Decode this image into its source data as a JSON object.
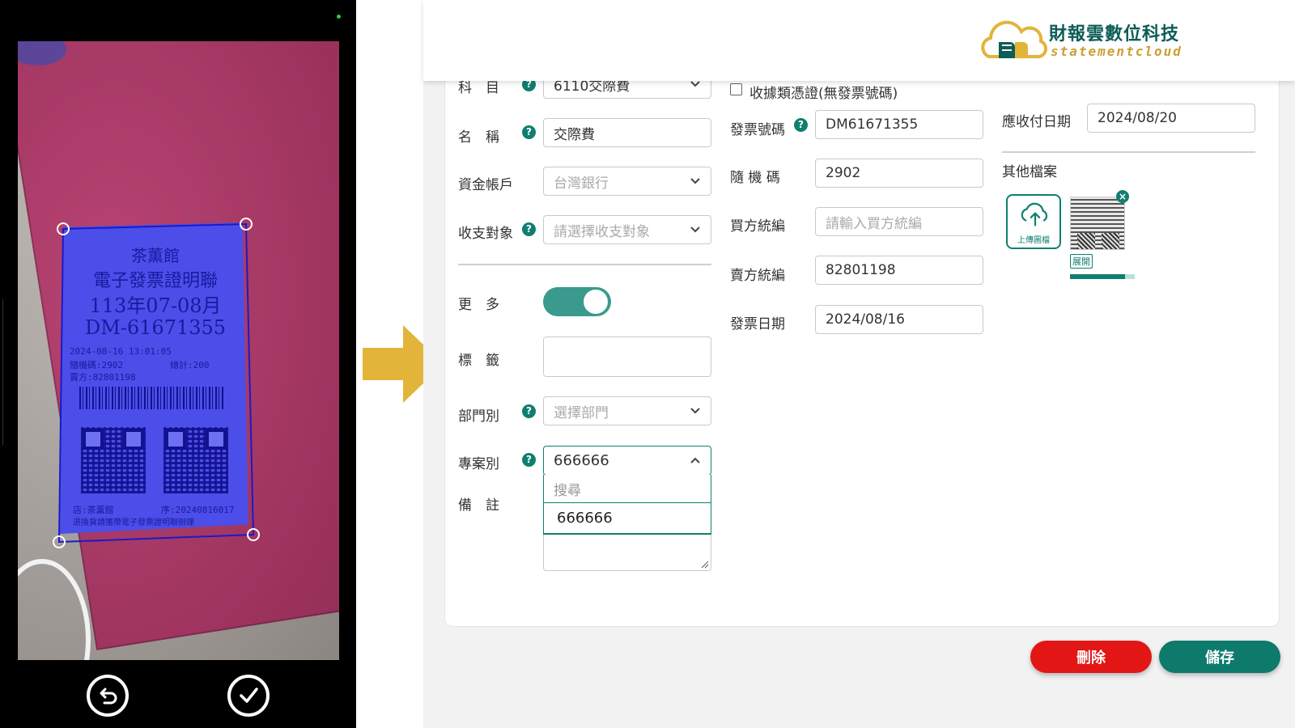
{
  "phone": {
    "receipt": {
      "store": "茶薫館",
      "title": "電子發票證明聯",
      "period": "113年07-08月",
      "number": "DM-61671355",
      "datetime": "2024-08-16 13:01:05",
      "random_code": "隨機碼:2902",
      "total": "總計:200",
      "seller": "賣方:82801198",
      "footer_store": "店:茶薫館",
      "footer_seq": "序:20240816017",
      "footer_note": "退換貨請攜帶電子發票證明聯辦理"
    },
    "icons": {
      "back": "undo-icon",
      "confirm": "check-icon"
    },
    "status_dot_color": "#2ecc40",
    "crop_overlay_color": "#4b4ee8"
  },
  "arrow_color": "#e2b43a",
  "brand": {
    "name_cn": "財報雲數位科技",
    "name_en": "statementcloud",
    "logo_icon": "cloud-book-logo",
    "primary": "#0d5c57",
    "accent": "#c9a033"
  },
  "form": {
    "account": {
      "label": "科　目",
      "value": "6110交際費"
    },
    "name": {
      "label": "名　稱",
      "value": "交際費"
    },
    "fund_account": {
      "label": "資金帳戶",
      "value": "台灣銀行"
    },
    "counterparty": {
      "label": "收支對象",
      "placeholder": "請選擇收支對象"
    },
    "more": {
      "label": "更　多",
      "enabled": true
    },
    "tags": {
      "label": "標　籤",
      "value": ""
    },
    "department": {
      "label": "部門別",
      "placeholder": "選擇部門"
    },
    "project": {
      "label": "專案別",
      "value": "666666",
      "search_placeholder": "搜尋",
      "options": [
        "666666"
      ]
    },
    "remark": {
      "label": "備　註",
      "value": ""
    },
    "receipt_voucher": {
      "label": "收據類憑證(無發票號碼)",
      "checked": false
    },
    "invoice_no": {
      "label": "發票號碼",
      "value": "DM61671355"
    },
    "random_code": {
      "label": "隨 機 碼",
      "value": "2902"
    },
    "buyer_tax_id": {
      "label": "買方統編",
      "placeholder": "請輸入買方統編"
    },
    "seller_tax_id": {
      "label": "賣方統編",
      "value": "82801198"
    },
    "invoice_date": {
      "label": "發票日期",
      "value": "2024/08/16"
    },
    "due_date": {
      "label": "應收付日期",
      "value": "2024/08/20"
    },
    "other_files": {
      "label": "其他檔案",
      "upload_label": "上傳圖檔",
      "expand_label": "展開",
      "upload_progress": 0.85
    },
    "buttons": {
      "delete": "刪除",
      "save": "儲存"
    },
    "colors": {
      "accent": "#0f7f6e",
      "delete": "#e31616",
      "save": "#0d7a6c",
      "toggle": "#3a9a8e"
    }
  }
}
